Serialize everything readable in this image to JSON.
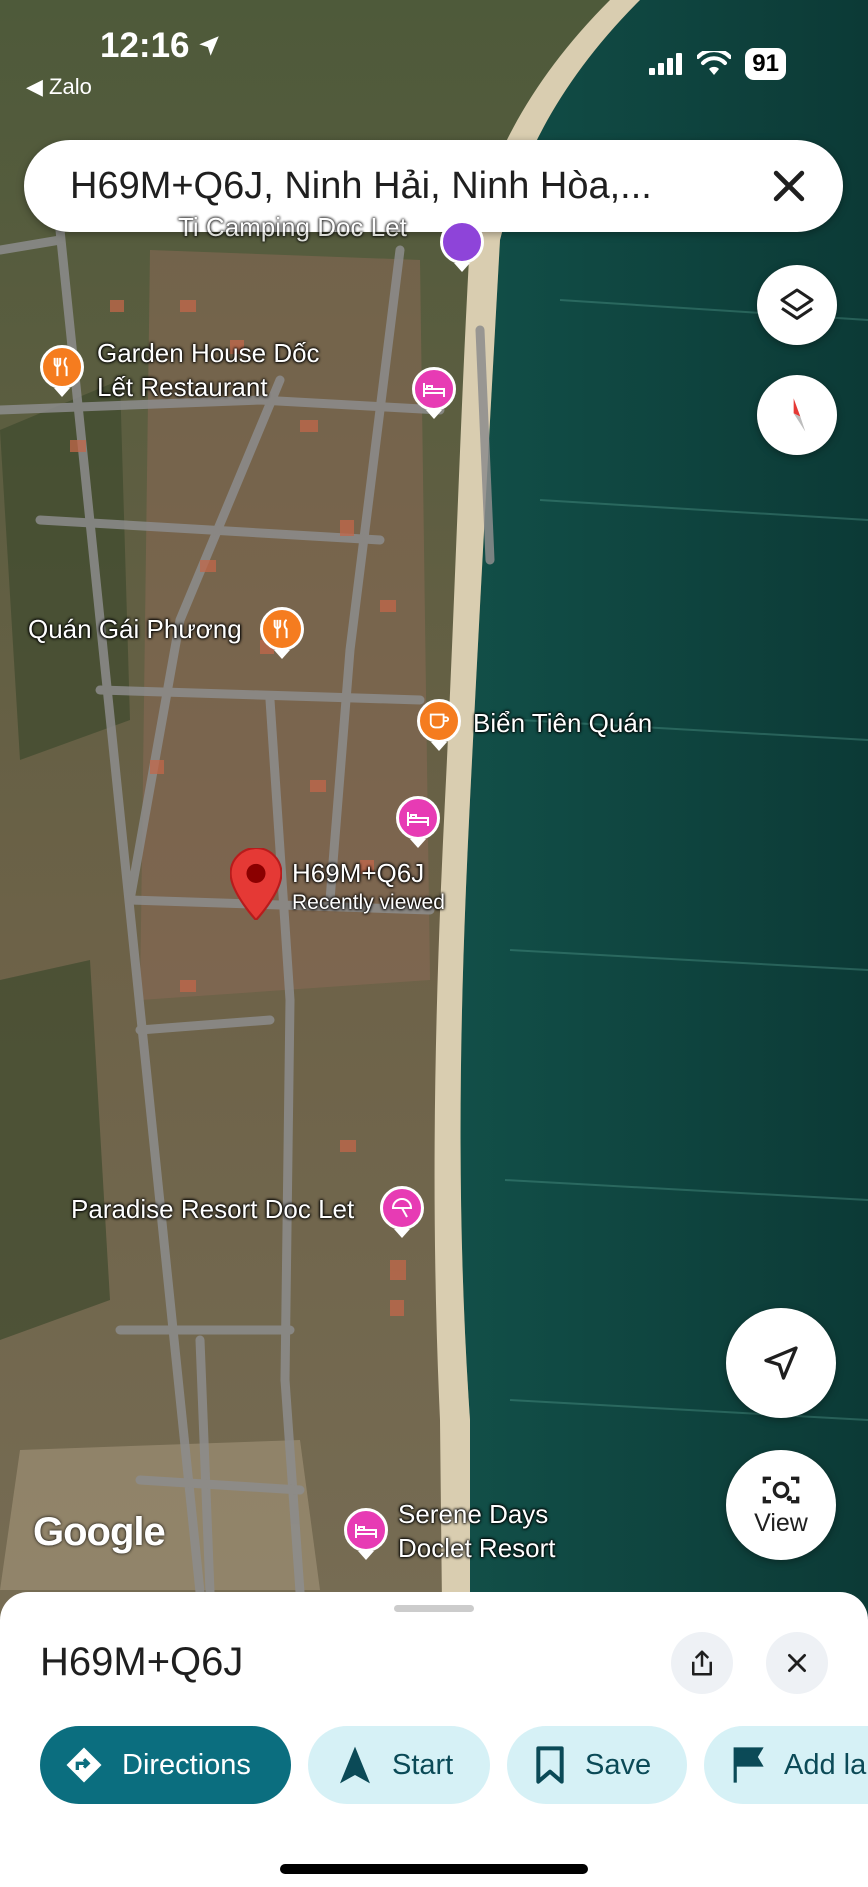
{
  "status_bar": {
    "time": "12:16",
    "back_app": "◀ Zalo",
    "battery": "91"
  },
  "search": {
    "query": "H69M+Q6J, Ninh Hải, Ninh Hòa,..."
  },
  "map": {
    "labels": {
      "camping_partial": "Ti Camping Doc Let",
      "garden_house_line1": "Garden House Dốc",
      "garden_house_line2": "Lết Restaurant",
      "quan_gai_phuong": "Quán Gái Phương",
      "bien_tien_quan": "Biển Tiên Quán",
      "pin_title": "H69M+Q6J",
      "pin_subtitle": "Recently viewed",
      "paradise_resort": "Paradise Resort Doc Let",
      "serene_days_line1": "Serene Days",
      "serene_days_line2": "Doclet Resort"
    },
    "google_logo": "Google",
    "view_button": "View"
  },
  "sheet": {
    "title": "H69M+Q6J",
    "actions": {
      "directions": "Directions",
      "start": "Start",
      "save": "Save",
      "add_label": "Add la"
    }
  },
  "colors": {
    "primary": "#0b6e7f",
    "tonal": "#d6f1f6",
    "pin": "#e53935",
    "food_poi": "#f57c1f",
    "hotel_poi": "#e73bb4"
  }
}
